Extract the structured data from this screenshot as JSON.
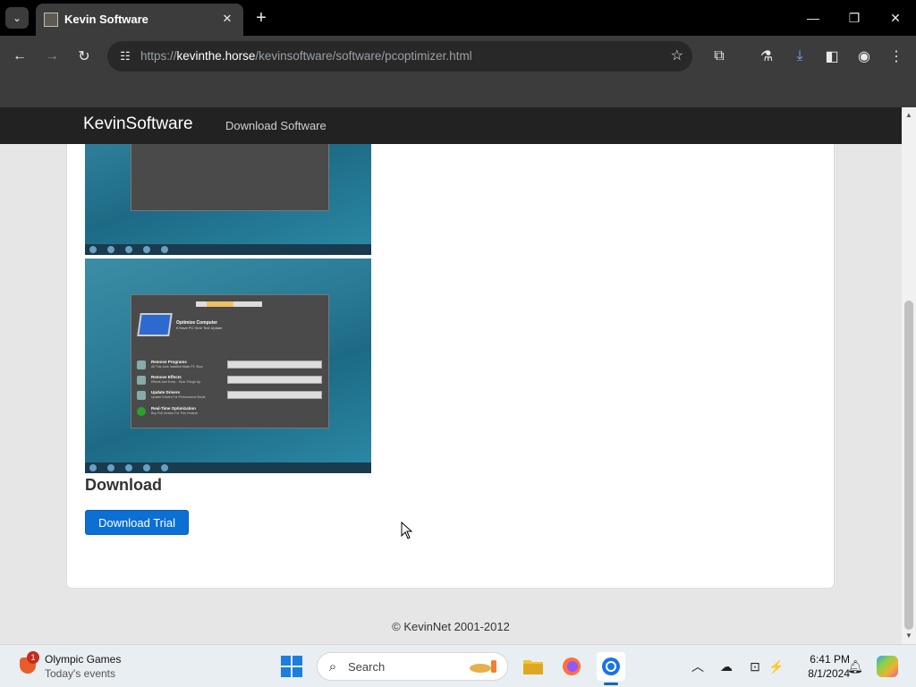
{
  "browser": {
    "tab": {
      "title": "Kevin Software",
      "close": "✕"
    },
    "new_tab": "+",
    "url": {
      "prefix": "https://",
      "host": "kevinthe.horse",
      "path": "/kevinsoftware/software/pcoptimizer.html"
    },
    "window_controls": {
      "minimize": "—",
      "maximize": "❐",
      "close": "✕"
    }
  },
  "site": {
    "brand": "KevinSoftware",
    "nav": [
      "Download Software"
    ],
    "download_heading": "Download",
    "download_button": "Download Trial",
    "footer": "© KevinNet 2001-2012"
  },
  "screenshot2": {
    "title": "Optimize Computer",
    "subtitle": "It Have PC Here Text Update",
    "rows": [
      {
        "title": "Remove Programs",
        "sub": "All This Junk Installed Make PC Slow"
      },
      {
        "title": "Remove Effects",
        "sub": "Effects Use Extra... Slow Things Up"
      },
      {
        "title": "Update Drivers",
        "sub": "Update Drivers For Performance Boost"
      },
      {
        "title": "Real-Time Optimization",
        "sub": "Buy Full Version For This Feature"
      }
    ]
  },
  "taskbar": {
    "widget": {
      "title": "Olympic Games",
      "subtitle": "Today's events",
      "badge": "1"
    },
    "search_placeholder": "Search",
    "clock": {
      "time": "6:41 PM",
      "date": "8/1/2024"
    }
  },
  "colors": {
    "accent": "#0b6fd4",
    "navbar": "#222222",
    "tab": "#3c3c3c"
  }
}
